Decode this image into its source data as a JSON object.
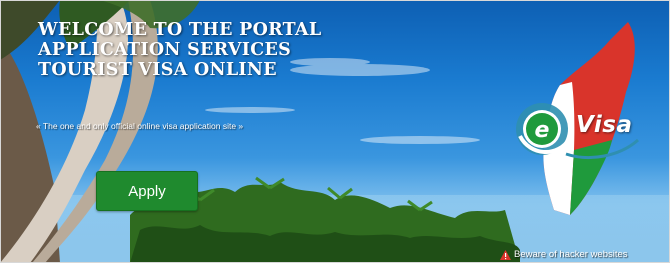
{
  "hero": {
    "title_lines": [
      "WELCOME TO THE PORTAL",
      "APPLICATION SERVICES",
      "TOURIST VISA ONLINE"
    ],
    "subtitle": "« The one and only official online visa application site »",
    "apply_label": "Apply",
    "warning_text": "Beware of hacker websites"
  },
  "logo": {
    "e_letter": "e",
    "visa_text": "Visa"
  },
  "colors": {
    "apply_button": "#1f8a2e",
    "map_red": "#d9342b",
    "map_green": "#1f9a3c",
    "sky": "#1a7bd0"
  },
  "icons": {
    "warning": "hacker-warning-icon",
    "logo_emblem": "e-circle-icon"
  }
}
